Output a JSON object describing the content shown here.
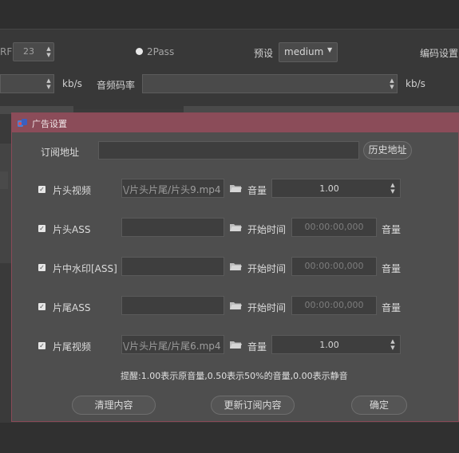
{
  "background": {
    "crf_label": "RF",
    "crf_value": "23",
    "two_pass_label": "2Pass",
    "preset_label": "预设",
    "preset_value": "medium",
    "encoder_settings_label": "编码设置",
    "video_bitrate_unit": "kb/s",
    "audio_bitrate_label": "音频码率",
    "audio_bitrate_unit": "kb/s"
  },
  "dialog": {
    "title": "广告设置",
    "subscription": {
      "label": "订阅地址",
      "value": "",
      "history_button": "历史地址"
    },
    "rows": [
      {
        "checkbox": "片头视频",
        "checked": true,
        "path": "\\/片头片尾/片头9.mp4",
        "extra_label": "音量",
        "volume": "1.00"
      },
      {
        "checkbox": "片头ASS",
        "checked": true,
        "path": "",
        "extra_label": "开始时间",
        "time": "00:00:00,000",
        "unit_label": "音量"
      },
      {
        "checkbox": "片中水印[ASS]",
        "checked": true,
        "path": "",
        "extra_label": "开始时间",
        "time": "00:00:00,000",
        "unit_label": "音量"
      },
      {
        "checkbox": "片尾ASS",
        "checked": true,
        "path": "",
        "extra_label": "开始时间",
        "time": "00:00:00,000",
        "unit_label": "音量"
      },
      {
        "checkbox": "片尾视频",
        "checked": true,
        "path": "\\/片头片尾/片尾6.mp4",
        "extra_label": "音量",
        "volume": "1.00"
      }
    ],
    "hint": "提醒:1.00表示原音量,0.50表示50%的音量,0.00表示静音",
    "buttons": {
      "clear": "清理内容",
      "update": "更新订阅内容",
      "ok": "确定"
    }
  },
  "colors": {
    "titlebar": "#8b4c59",
    "dialog_bg": "#4e4e4e",
    "app_bg": "#3a3a3a"
  }
}
